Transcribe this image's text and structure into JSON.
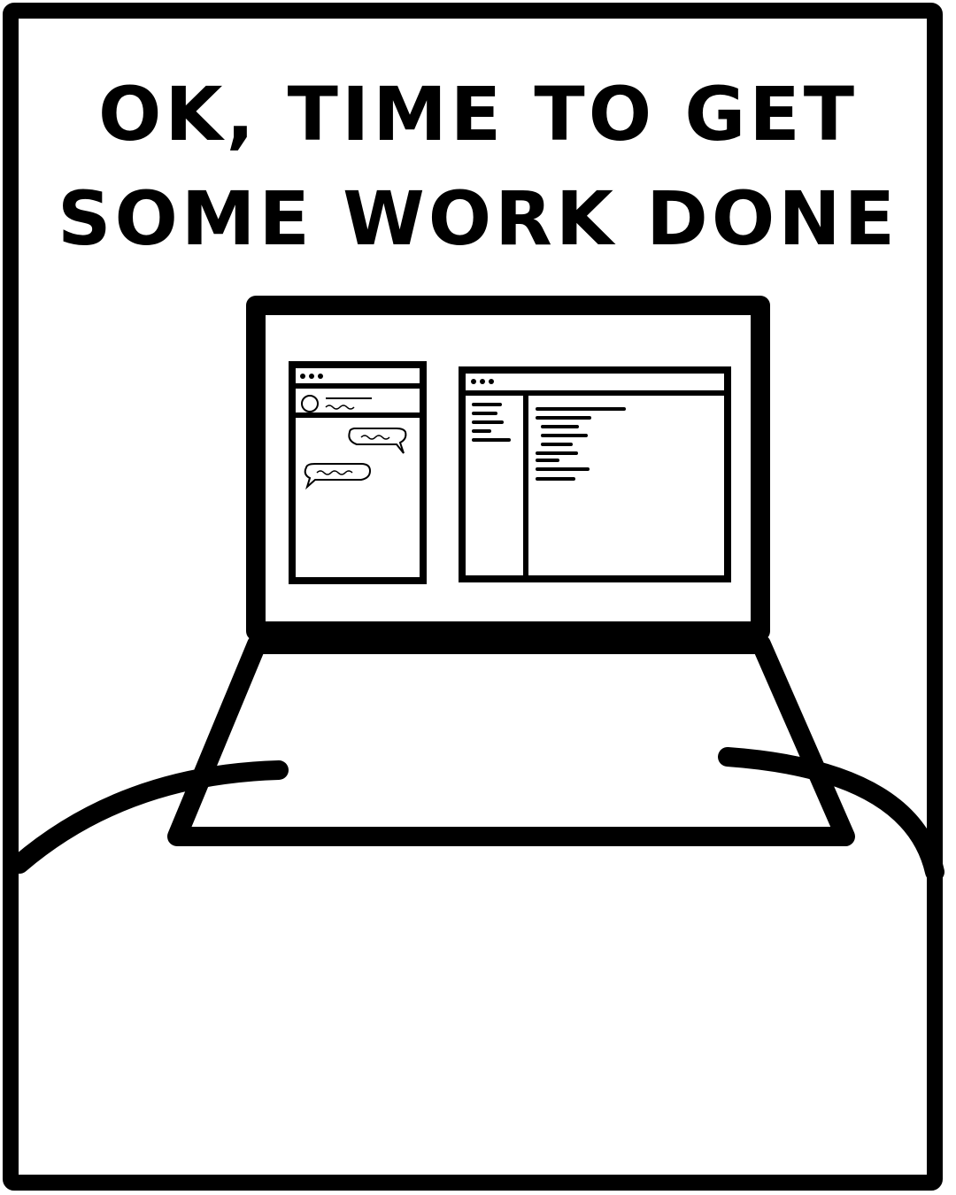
{
  "caption": {
    "line1": "OK, TIME TO GET",
    "line2": "SOME WORK DONE"
  },
  "colors": {
    "ink": "#000000",
    "paper": "#ffffff"
  },
  "icons": {
    "chat_window": "chat-window-icon",
    "code_window": "code-editor-window-icon",
    "laptop": "laptop-icon"
  }
}
